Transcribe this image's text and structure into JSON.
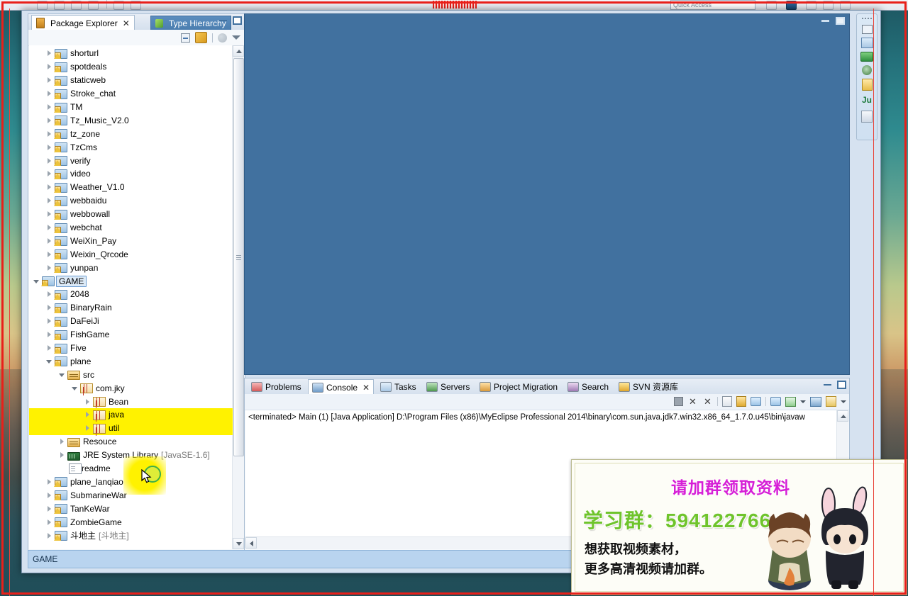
{
  "app": {
    "ide_name": "MyEclipse Professional 2014",
    "quick_access_placeholder": "Quick Access"
  },
  "explorer": {
    "tabs": [
      {
        "label": "Package Explorer",
        "icon": "package-explorer-icon",
        "active": true,
        "closable": true
      },
      {
        "label": "Type Hierarchy",
        "icon": "type-hierarchy-icon",
        "active": false,
        "closable": false
      }
    ],
    "view_buttons": [
      {
        "name": "minimize-view-button",
        "label": "–"
      },
      {
        "name": "maximize-view-button",
        "label": "■"
      }
    ],
    "toolbar": [
      {
        "name": "collapse-all-icon",
        "label": "Collapse All"
      },
      {
        "name": "link-with-editor-icon",
        "label": "Link with Editor"
      },
      {
        "name": "filter-icon",
        "label": "Filters"
      },
      {
        "name": "view-menu-icon",
        "label": "View Menu"
      }
    ],
    "tree": [
      {
        "label": "shorturl",
        "indent": 1,
        "state": "closed",
        "icon": "java-project-icon"
      },
      {
        "label": "spotdeals",
        "indent": 1,
        "state": "closed",
        "icon": "java-project-icon"
      },
      {
        "label": "staticweb",
        "indent": 1,
        "state": "closed",
        "icon": "java-project-icon"
      },
      {
        "label": "Stroke_chat",
        "indent": 1,
        "state": "closed",
        "icon": "java-project-icon"
      },
      {
        "label": "TM",
        "indent": 1,
        "state": "closed",
        "icon": "java-project-icon"
      },
      {
        "label": "Tz_Music_V2.0",
        "indent": 1,
        "state": "closed",
        "icon": "java-project-icon"
      },
      {
        "label": "tz_zone",
        "indent": 1,
        "state": "closed",
        "icon": "java-project-icon"
      },
      {
        "label": "TzCms",
        "indent": 1,
        "state": "closed",
        "icon": "java-project-icon"
      },
      {
        "label": "verify",
        "indent": 1,
        "state": "closed",
        "icon": "java-project-icon"
      },
      {
        "label": "video",
        "indent": 1,
        "state": "closed",
        "icon": "java-project-icon"
      },
      {
        "label": "Weather_V1.0",
        "indent": 1,
        "state": "closed",
        "icon": "java-project-icon"
      },
      {
        "label": "webbaidu",
        "indent": 1,
        "state": "closed",
        "icon": "java-project-icon"
      },
      {
        "label": "webbowall",
        "indent": 1,
        "state": "closed",
        "icon": "java-project-icon"
      },
      {
        "label": "webchat",
        "indent": 1,
        "state": "closed",
        "icon": "java-project-icon"
      },
      {
        "label": "WeiXin_Pay",
        "indent": 1,
        "state": "closed",
        "icon": "java-project-icon"
      },
      {
        "label": "Weixin_Qrcode",
        "indent": 1,
        "state": "closed",
        "icon": "java-project-icon"
      },
      {
        "label": "yunpan",
        "indent": 1,
        "state": "closed",
        "icon": "java-project-icon"
      },
      {
        "label": "GAME",
        "indent": 0,
        "state": "open",
        "icon": "working-set-icon",
        "selected": true
      },
      {
        "label": "2048",
        "indent": 1,
        "state": "closed",
        "icon": "java-project-icon"
      },
      {
        "label": "BinaryRain",
        "indent": 1,
        "state": "closed",
        "icon": "java-project-icon"
      },
      {
        "label": "DaFeiJi",
        "indent": 1,
        "state": "closed",
        "icon": "java-project-icon"
      },
      {
        "label": "FishGame",
        "indent": 1,
        "state": "closed",
        "icon": "java-project-icon"
      },
      {
        "label": "Five",
        "indent": 1,
        "state": "closed",
        "icon": "java-project-icon"
      },
      {
        "label": "plane",
        "indent": 1,
        "state": "open",
        "icon": "java-project-icon"
      },
      {
        "label": "src",
        "indent": 2,
        "state": "open",
        "icon": "source-folder-icon"
      },
      {
        "label": "com.jky",
        "indent": 3,
        "state": "open",
        "icon": "package-icon"
      },
      {
        "label": "Bean",
        "indent": 4,
        "state": "closed",
        "icon": "package-icon"
      },
      {
        "label": "java",
        "indent": 4,
        "state": "closed",
        "icon": "package-icon",
        "highlight": true
      },
      {
        "label": "util",
        "indent": 4,
        "state": "closed",
        "icon": "package-icon",
        "highlight": true,
        "covered_by_cursor": true
      },
      {
        "label": "Resouce",
        "indent": 2,
        "state": "closed",
        "icon": "source-folder-icon"
      },
      {
        "label": "JRE System Library",
        "indent": 2,
        "state": "closed",
        "icon": "jre-library-icon",
        "dim": "[JavaSE-1.6]"
      },
      {
        "label": "readme",
        "indent": 2,
        "state": "none",
        "icon": "file-icon"
      },
      {
        "label": "plane_lanqiao",
        "indent": 1,
        "state": "closed",
        "icon": "java-project-icon"
      },
      {
        "label": "SubmarineWar",
        "indent": 1,
        "state": "closed",
        "icon": "java-project-icon"
      },
      {
        "label": "TanKeWar",
        "indent": 1,
        "state": "closed",
        "icon": "java-project-icon"
      },
      {
        "label": "ZombieGame",
        "indent": 1,
        "state": "closed",
        "icon": "java-project-icon"
      },
      {
        "label": "斗地主",
        "indent": 1,
        "state": "closed",
        "icon": "java-project-icon",
        "dim": "[斗地主]"
      }
    ]
  },
  "editor": {
    "background_color": "#41719f",
    "buttons": [
      {
        "name": "minimize-editor-button",
        "label": "Minimize"
      },
      {
        "name": "maximize-editor-button",
        "label": "Maximize"
      }
    ]
  },
  "console": {
    "tabs": [
      {
        "label": "Problems",
        "icon": "problems-icon",
        "active": false,
        "closable": false
      },
      {
        "label": "Console",
        "icon": "console-icon",
        "active": true,
        "closable": true
      },
      {
        "label": "Tasks",
        "icon": "tasks-icon",
        "active": false,
        "closable": false
      },
      {
        "label": "Servers",
        "icon": "servers-icon",
        "active": false,
        "closable": false
      },
      {
        "label": "Project Migration",
        "icon": "project-migration-icon",
        "active": false,
        "closable": false
      },
      {
        "label": "Search",
        "icon": "search-icon",
        "active": false,
        "closable": false
      },
      {
        "label": "SVN 资源库",
        "icon": "svn-repository-icon",
        "active": false,
        "closable": false
      }
    ],
    "toolbar": [
      {
        "name": "terminate-icon",
        "label": "Terminate"
      },
      {
        "name": "remove-launch-icon",
        "label": "Remove Launch"
      },
      {
        "name": "remove-all-terminated-icon",
        "label": "Remove All Terminated Launches"
      },
      {
        "name": "clear-console-icon",
        "label": "Clear Console"
      },
      {
        "name": "scroll-lock-icon",
        "label": "Scroll Lock"
      },
      {
        "name": "word-wrap-icon",
        "label": "Word Wrap"
      },
      {
        "name": "pin-console-icon",
        "label": "Pin Console"
      },
      {
        "name": "new-console-view-icon",
        "label": "New Console View"
      },
      {
        "name": "display-console-icon",
        "label": "Display Selected Console"
      },
      {
        "name": "open-console-icon",
        "label": "Open Console"
      }
    ],
    "view_buttons": [
      {
        "name": "minimize-console-button",
        "label": "–"
      },
      {
        "name": "maximize-console-button",
        "label": "■"
      }
    ],
    "output": "<terminated> Main (1) [Java Application] D:\\Program Files (x86)\\MyEclipse Professional 2014\\binary\\com.sun.java.jdk7.win32.x86_64_1.7.0.u45\\bin\\javaw"
  },
  "fastview": {
    "items": [
      {
        "name": "restore-icon",
        "label": "Restore"
      },
      {
        "name": "outline-icon",
        "label": "Outline"
      },
      {
        "name": "servers-icon",
        "label": "Servers"
      },
      {
        "name": "debug-icon",
        "label": "Debug"
      },
      {
        "name": "task-list-icon",
        "label": "Task List"
      },
      {
        "name": "junit-icon",
        "label": "Ju"
      },
      {
        "name": "snippets-icon",
        "label": "Snippets"
      }
    ]
  },
  "statusbar": {
    "text": "GAME"
  },
  "ad_overlay": {
    "title": "请加群领取资料",
    "group_label": "学习群：",
    "group_number": "594122766",
    "line1": "想获取视频素材，",
    "line2": "更多高清视频请加群。",
    "title_color": "#d61fd6",
    "group_color": "#6fc42c"
  },
  "recording": {
    "border_color": "#e8201a"
  }
}
